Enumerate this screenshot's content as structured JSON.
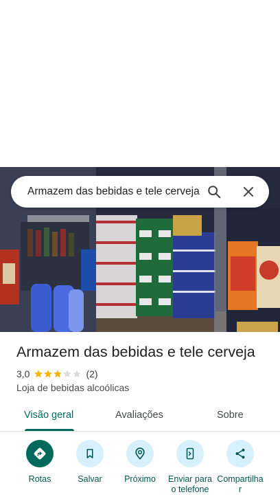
{
  "search": {
    "query": "Armazem das bebidas e tele cerveja"
  },
  "place": {
    "name": "Armazem das bebidas e tele cerveja",
    "rating": "3,0",
    "review_count": "(2)",
    "category": "Loja de bebidas alcoólicas",
    "stars_filled": 3,
    "stars_total": 5
  },
  "tabs": [
    {
      "label": "Visão geral",
      "active": true
    },
    {
      "label": "Avaliações",
      "active": false
    },
    {
      "label": "Sobre",
      "active": false
    }
  ],
  "actions": [
    {
      "label": "Rotas",
      "icon": "directions-icon"
    },
    {
      "label": "Salvar",
      "icon": "bookmark-icon"
    },
    {
      "label": "Próximo",
      "icon": "nearby-icon"
    },
    {
      "label": "Enviar para o telefone",
      "icon": "send-to-phone-icon"
    },
    {
      "label": "Compartilhar",
      "icon": "share-icon"
    }
  ],
  "colors": {
    "accent": "#00695c",
    "action_bg": "#d6f1fb",
    "star": "#f4b400"
  }
}
